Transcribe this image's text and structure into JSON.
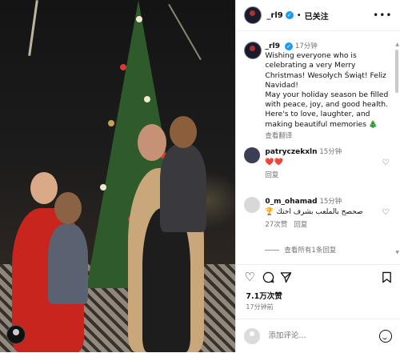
{
  "post": {
    "username": "_rl9",
    "verified_mark": "✓",
    "dot": "•",
    "follow_label": "已关注",
    "more_label": "•••"
  },
  "caption": {
    "username": "_rl9",
    "time": "17分钟",
    "text": "Wishing everyone who is celebrating a very Merry Christmas! Wesołych Świąt! Feliz Navidad!\nMay your holiday season be filled with peace, joy, and good health. Here's to love, laughter, and making beautiful memories 🎄",
    "translate": "查看翻译"
  },
  "comments": [
    {
      "username": "patryczekxln",
      "time": "15分钟",
      "text": "❤️❤️",
      "reply": "回复"
    },
    {
      "username": "0_m_ohamad",
      "time": "15分钟",
      "text": "صحصح بالملعب بشرف اختك 🏆",
      "likes": "27次赞",
      "reply": "回复"
    }
  ],
  "view_replies": "查看所有1条回复",
  "stats": {
    "likes": "7.1万次赞",
    "time": "17分钟前"
  },
  "icons": {
    "like": "heart-icon",
    "comment": "comment-icon",
    "share": "share-icon",
    "save": "bookmark-icon",
    "emoji": "emoji-icon"
  },
  "comment_input": {
    "placeholder": "添加评论..."
  },
  "colors": {
    "verified": "#1d9bf0",
    "heart": "#e0243d",
    "muted": "#737373"
  }
}
